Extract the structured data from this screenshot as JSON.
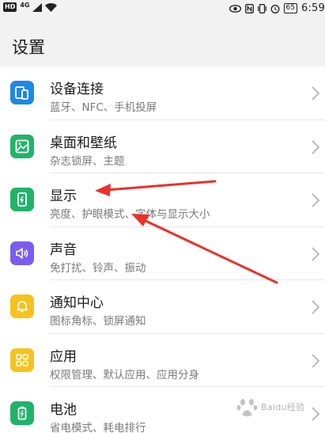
{
  "status_bar": {
    "hd": "HD",
    "network": "4G",
    "battery": "65",
    "time": "6:59"
  },
  "header": {
    "title": "设置"
  },
  "items": [
    {
      "title": "设备连接",
      "subtitle": "蓝牙、NFC、手机投屏",
      "icon": "device-connection-icon",
      "color": "#1e88e5"
    },
    {
      "title": "桌面和壁纸",
      "subtitle": "杂志锁屏、主题",
      "icon": "wallpaper-icon",
      "color": "#21b36b"
    },
    {
      "title": "显示",
      "subtitle": "亮度、护眼模式、字体与显示大小",
      "icon": "display-icon",
      "color": "#21b36b"
    },
    {
      "title": "声音",
      "subtitle": "免打扰、铃声、振动",
      "icon": "sound-icon",
      "color": "#7b5cf0"
    },
    {
      "title": "通知中心",
      "subtitle": "图标角标、锁屏通知",
      "icon": "bell-icon",
      "color": "#f7c21d"
    },
    {
      "title": "应用",
      "subtitle": "权限管理、默认应用、应用分身",
      "icon": "apps-grid-icon",
      "color": "#f7c21d"
    },
    {
      "title": "电池",
      "subtitle": "省电模式、耗电排行",
      "icon": "battery-icon",
      "color": "#21b36b"
    }
  ],
  "annotation": {
    "arrow_color": "#e8322b"
  },
  "watermark": {
    "text": "Baidu经验"
  }
}
